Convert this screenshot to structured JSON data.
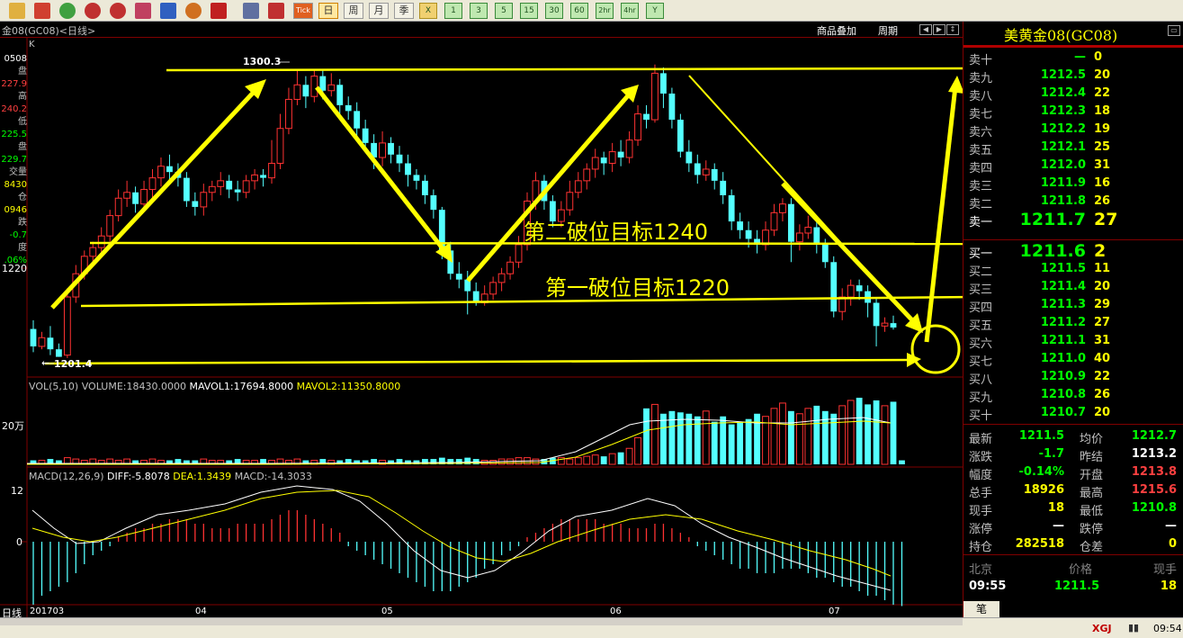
{
  "toolbar": {
    "buttons": [
      "daily",
      "weekly",
      "monthly",
      "quarterly",
      "yearly"
    ],
    "period_labels": [
      "日",
      "周",
      "月",
      "季"
    ],
    "minute_labels": [
      "1",
      "3",
      "5",
      "15",
      "30",
      "60",
      "2hr",
      "4hr",
      "Y"
    ],
    "tick_label": "Tick",
    "close_x": "X"
  },
  "header": {
    "title": "金08(GC08)<日线>",
    "overlay_link": "商品叠加",
    "period_link": "周期",
    "k_label": "K"
  },
  "left_info": [
    {
      "text": "0508",
      "color": "#ffffff"
    },
    {
      "text": "盘",
      "color": "#c0c0c0"
    },
    {
      "text": "227.9",
      "color": "#ff4040"
    },
    {
      "text": "高",
      "color": "#c0c0c0"
    },
    {
      "text": "240.2",
      "color": "#ff4040"
    },
    {
      "text": "低",
      "color": "#c0c0c0"
    },
    {
      "text": "225.5",
      "color": "#00ff00"
    },
    {
      "text": "盘",
      "color": "#c0c0c0"
    },
    {
      "text": "229.7",
      "color": "#00ff00"
    },
    {
      "text": "交量",
      "color": "#c0c0c0"
    },
    {
      "text": "8430",
      "color": "#ffff00"
    },
    {
      "text": "仓",
      "color": "#c0c0c0"
    },
    {
      "text": "0946",
      "color": "#ffff00"
    },
    {
      "text": "跌",
      "color": "#c0c0c0"
    },
    {
      "text": "-0.7",
      "color": "#00ff00"
    },
    {
      "text": "度",
      "color": "#c0c0c0"
    },
    {
      "text": ".06%",
      "color": "#00ff00"
    }
  ],
  "price_axis": {
    "label_1220": "1220"
  },
  "annotations": {
    "high_label": "1300.3",
    "low_label": "1201.4",
    "target2": "第二破位目标1240",
    "target1": "第一破位目标1220"
  },
  "volume_legend": {
    "prefix": "VOL(5,10)",
    "volume": "VOLUME:18430.0000",
    "mavol1": "MAVOL1:17694.8000",
    "mavol2": "MAVOL2:11350.8000",
    "axis_label": "20万"
  },
  "macd_legend": {
    "prefix": "MACD(12,26,9)",
    "diff": "DIFF:-5.8078",
    "dea": "DEA:1.3439",
    "macd": "MACD:-14.3033",
    "axis_top": "12",
    "axis_zero": "0"
  },
  "x_axis": {
    "period_label": "日线",
    "ticks": [
      "201703",
      "04",
      "05",
      "06",
      "07"
    ]
  },
  "colors": {
    "up": "#ff3232",
    "down": "#54ffff",
    "annotation": "#ffff00",
    "grid": "#800000"
  },
  "right_panel": {
    "title": "美黄金08(GC08)",
    "sell_rows": [
      {
        "label": "卖十",
        "price": "—",
        "qty": "0"
      },
      {
        "label": "卖九",
        "price": "1212.5",
        "qty": "20"
      },
      {
        "label": "卖八",
        "price": "1212.4",
        "qty": "22"
      },
      {
        "label": "卖七",
        "price": "1212.3",
        "qty": "18"
      },
      {
        "label": "卖六",
        "price": "1212.2",
        "qty": "19"
      },
      {
        "label": "卖五",
        "price": "1212.1",
        "qty": "25"
      },
      {
        "label": "卖四",
        "price": "1212.0",
        "qty": "31"
      },
      {
        "label": "卖三",
        "price": "1211.9",
        "qty": "16"
      },
      {
        "label": "卖二",
        "price": "1211.8",
        "qty": "26"
      },
      {
        "label": "卖一",
        "price": "1211.7",
        "qty": "27"
      }
    ],
    "buy_rows": [
      {
        "label": "买一",
        "price": "1211.6",
        "qty": "2"
      },
      {
        "label": "买二",
        "price": "1211.5",
        "qty": "11"
      },
      {
        "label": "买三",
        "price": "1211.4",
        "qty": "20"
      },
      {
        "label": "买四",
        "price": "1211.3",
        "qty": "29"
      },
      {
        "label": "买五",
        "price": "1211.2",
        "qty": "27"
      },
      {
        "label": "买六",
        "price": "1211.1",
        "qty": "31"
      },
      {
        "label": "买七",
        "price": "1211.0",
        "qty": "40"
      },
      {
        "label": "买八",
        "price": "1210.9",
        "qty": "22"
      },
      {
        "label": "买九",
        "price": "1210.8",
        "qty": "26"
      },
      {
        "label": "买十",
        "price": "1210.7",
        "qty": "20"
      }
    ],
    "stats": [
      {
        "l1": "最新",
        "v1": "1211.5",
        "c1": "#00ff00",
        "l2": "均价",
        "v2": "1212.7",
        "c2": "#00ff00"
      },
      {
        "l1": "涨跌",
        "v1": "-1.7",
        "c1": "#00ff00",
        "l2": "昨结",
        "v2": "1213.2",
        "c2": "#ffffff"
      },
      {
        "l1": "幅度",
        "v1": "-0.14%",
        "c1": "#00ff00",
        "l2": "开盘",
        "v2": "1213.8",
        "c2": "#ff4040"
      },
      {
        "l1": "总手",
        "v1": "18926",
        "c1": "#ffff00",
        "l2": "最高",
        "v2": "1215.6",
        "c2": "#ff4040"
      },
      {
        "l1": "现手",
        "v1": "18",
        "c1": "#ffff00",
        "l2": "最低",
        "v2": "1210.8",
        "c2": "#00ff00"
      },
      {
        "l1": "涨停",
        "v1": "—",
        "c1": "#ffffff",
        "l2": "跌停",
        "v2": "—",
        "c2": "#ffffff"
      },
      {
        "l1": "持仓",
        "v1": "282518",
        "c1": "#ffff00",
        "l2": "仓差",
        "v2": "0",
        "c2": "#ffff00"
      }
    ],
    "tick_header": {
      "place": "北京",
      "price": "价格",
      "qty": "现手"
    },
    "tick_row": {
      "time": "09:55",
      "price": "1211.5",
      "qty": "18"
    },
    "tab": "笔"
  },
  "status": {
    "brand": "XGJ",
    "time": "09:54"
  },
  "chart_data": {
    "type": "candlestick",
    "price_axis_labels": [
      "1220"
    ],
    "price_range": [
      1196,
      1305
    ],
    "high": 1300.3,
    "low": 1201.4,
    "target_lines": [
      1240,
      1220
    ],
    "candles": [
      {
        "o": 1211,
        "c": 1205,
        "h": 1214,
        "l": 1203
      },
      {
        "o": 1205,
        "c": 1208,
        "h": 1210,
        "l": 1204
      },
      {
        "o": 1208,
        "c": 1204,
        "h": 1212,
        "l": 1202
      },
      {
        "o": 1204,
        "c": 1201.4,
        "h": 1206,
        "l": 1201.4
      },
      {
        "o": 1202,
        "c": 1222,
        "h": 1225,
        "l": 1201
      },
      {
        "o": 1222,
        "c": 1230,
        "h": 1233,
        "l": 1220
      },
      {
        "o": 1230,
        "c": 1236,
        "h": 1238,
        "l": 1228
      },
      {
        "o": 1236,
        "c": 1239,
        "h": 1241,
        "l": 1233
      },
      {
        "o": 1239,
        "c": 1243,
        "h": 1246,
        "l": 1237
      },
      {
        "o": 1243,
        "c": 1250,
        "h": 1252,
        "l": 1241
      },
      {
        "o": 1250,
        "c": 1256,
        "h": 1259,
        "l": 1248
      },
      {
        "o": 1256,
        "c": 1258,
        "h": 1262,
        "l": 1253
      },
      {
        "o": 1258,
        "c": 1254,
        "h": 1260,
        "l": 1251
      },
      {
        "o": 1254,
        "c": 1259,
        "h": 1262,
        "l": 1252
      },
      {
        "o": 1259,
        "c": 1263,
        "h": 1266,
        "l": 1256
      },
      {
        "o": 1263,
        "c": 1267,
        "h": 1270,
        "l": 1260
      },
      {
        "o": 1267,
        "c": 1265,
        "h": 1271,
        "l": 1262
      },
      {
        "o": 1265,
        "c": 1263,
        "h": 1268,
        "l": 1260
      },
      {
        "o": 1263,
        "c": 1255,
        "h": 1265,
        "l": 1253
      },
      {
        "o": 1255,
        "c": 1253,
        "h": 1258,
        "l": 1250
      },
      {
        "o": 1253,
        "c": 1258,
        "h": 1261,
        "l": 1250
      },
      {
        "o": 1258,
        "c": 1260,
        "h": 1262,
        "l": 1255
      },
      {
        "o": 1260,
        "c": 1262,
        "h": 1265,
        "l": 1257
      },
      {
        "o": 1262,
        "c": 1259,
        "h": 1264,
        "l": 1256
      },
      {
        "o": 1259,
        "c": 1258,
        "h": 1262,
        "l": 1255
      },
      {
        "o": 1258,
        "c": 1262,
        "h": 1264,
        "l": 1256
      },
      {
        "o": 1262,
        "c": 1264,
        "h": 1266,
        "l": 1259
      },
      {
        "o": 1264,
        "c": 1263,
        "h": 1266,
        "l": 1260
      },
      {
        "o": 1263,
        "c": 1268,
        "h": 1276,
        "l": 1261
      },
      {
        "o": 1268,
        "c": 1280,
        "h": 1285,
        "l": 1266
      },
      {
        "o": 1280,
        "c": 1290,
        "h": 1294,
        "l": 1278
      },
      {
        "o": 1290,
        "c": 1295,
        "h": 1300.3,
        "l": 1288
      },
      {
        "o": 1295,
        "c": 1291,
        "h": 1298,
        "l": 1287
      },
      {
        "o": 1291,
        "c": 1298,
        "h": 1300,
        "l": 1289
      },
      {
        "o": 1298,
        "c": 1293,
        "h": 1300,
        "l": 1290
      },
      {
        "o": 1293,
        "c": 1295,
        "h": 1299,
        "l": 1291
      },
      {
        "o": 1295,
        "c": 1288,
        "h": 1297,
        "l": 1285
      },
      {
        "o": 1288,
        "c": 1286,
        "h": 1291,
        "l": 1283
      },
      {
        "o": 1286,
        "c": 1280,
        "h": 1289,
        "l": 1277
      },
      {
        "o": 1280,
        "c": 1275,
        "h": 1283,
        "l": 1272
      },
      {
        "o": 1275,
        "c": 1270,
        "h": 1278,
        "l": 1266
      },
      {
        "o": 1270,
        "c": 1275,
        "h": 1279,
        "l": 1267
      },
      {
        "o": 1275,
        "c": 1271,
        "h": 1277,
        "l": 1268
      },
      {
        "o": 1271,
        "c": 1268,
        "h": 1274,
        "l": 1265
      },
      {
        "o": 1268,
        "c": 1264,
        "h": 1271,
        "l": 1260
      },
      {
        "o": 1264,
        "c": 1262,
        "h": 1266,
        "l": 1259
      },
      {
        "o": 1262,
        "c": 1257,
        "h": 1264,
        "l": 1254
      },
      {
        "o": 1257,
        "c": 1252,
        "h": 1259,
        "l": 1249
      },
      {
        "o": 1252,
        "c": 1238,
        "h": 1253,
        "l": 1235
      },
      {
        "o": 1238,
        "c": 1230,
        "h": 1241,
        "l": 1228
      },
      {
        "o": 1230,
        "c": 1228,
        "h": 1234,
        "l": 1225
      },
      {
        "o": 1228,
        "c": 1224,
        "h": 1231,
        "l": 1216
      },
      {
        "o": 1224,
        "c": 1220,
        "h": 1227,
        "l": 1219
      },
      {
        "o": 1220,
        "c": 1223,
        "h": 1226,
        "l": 1219
      },
      {
        "o": 1223,
        "c": 1227,
        "h": 1229,
        "l": 1221
      },
      {
        "o": 1227,
        "c": 1230,
        "h": 1232,
        "l": 1224
      },
      {
        "o": 1230,
        "c": 1234,
        "h": 1236,
        "l": 1228
      },
      {
        "o": 1234,
        "c": 1240,
        "h": 1243,
        "l": 1232
      },
      {
        "o": 1240,
        "c": 1255,
        "h": 1258,
        "l": 1238
      },
      {
        "o": 1255,
        "c": 1262,
        "h": 1265,
        "l": 1252
      },
      {
        "o": 1262,
        "c": 1255,
        "h": 1264,
        "l": 1252
      },
      {
        "o": 1255,
        "c": 1248,
        "h": 1257,
        "l": 1246
      },
      {
        "o": 1248,
        "c": 1252,
        "h": 1255,
        "l": 1246
      },
      {
        "o": 1252,
        "c": 1258,
        "h": 1262,
        "l": 1250
      },
      {
        "o": 1258,
        "c": 1262,
        "h": 1265,
        "l": 1256
      },
      {
        "o": 1262,
        "c": 1266,
        "h": 1268,
        "l": 1259
      },
      {
        "o": 1266,
        "c": 1270,
        "h": 1273,
        "l": 1263
      },
      {
        "o": 1270,
        "c": 1268,
        "h": 1272,
        "l": 1264
      },
      {
        "o": 1268,
        "c": 1272,
        "h": 1275,
        "l": 1265
      },
      {
        "o": 1272,
        "c": 1270,
        "h": 1276,
        "l": 1267
      },
      {
        "o": 1270,
        "c": 1276,
        "h": 1279,
        "l": 1268
      },
      {
        "o": 1276,
        "c": 1285,
        "h": 1288,
        "l": 1274
      },
      {
        "o": 1285,
        "c": 1283,
        "h": 1288,
        "l": 1280
      },
      {
        "o": 1283,
        "c": 1299,
        "h": 1302,
        "l": 1282
      },
      {
        "o": 1299,
        "c": 1292,
        "h": 1301,
        "l": 1287
      },
      {
        "o": 1292,
        "c": 1283,
        "h": 1294,
        "l": 1280
      },
      {
        "o": 1283,
        "c": 1272,
        "h": 1285,
        "l": 1270
      },
      {
        "o": 1272,
        "c": 1268,
        "h": 1276,
        "l": 1265
      },
      {
        "o": 1268,
        "c": 1264,
        "h": 1271,
        "l": 1261
      },
      {
        "o": 1264,
        "c": 1266,
        "h": 1269,
        "l": 1262
      },
      {
        "o": 1266,
        "c": 1262,
        "h": 1268,
        "l": 1259
      },
      {
        "o": 1262,
        "c": 1257,
        "h": 1265,
        "l": 1254
      },
      {
        "o": 1257,
        "c": 1248,
        "h": 1259,
        "l": 1245
      },
      {
        "o": 1248,
        "c": 1245,
        "h": 1251,
        "l": 1242
      },
      {
        "o": 1245,
        "c": 1242,
        "h": 1248,
        "l": 1239
      },
      {
        "o": 1242,
        "c": 1240,
        "h": 1245,
        "l": 1237
      },
      {
        "o": 1240,
        "c": 1245,
        "h": 1248,
        "l": 1238
      },
      {
        "o": 1245,
        "c": 1251,
        "h": 1254,
        "l": 1243
      },
      {
        "o": 1251,
        "c": 1254,
        "h": 1256,
        "l": 1248
      },
      {
        "o": 1254,
        "c": 1241,
        "h": 1256,
        "l": 1234
      },
      {
        "o": 1241,
        "c": 1244,
        "h": 1247,
        "l": 1238
      },
      {
        "o": 1244,
        "c": 1246,
        "h": 1250,
        "l": 1242
      },
      {
        "o": 1246,
        "c": 1240,
        "h": 1248,
        "l": 1237
      },
      {
        "o": 1240,
        "c": 1234,
        "h": 1242,
        "l": 1232
      },
      {
        "o": 1234,
        "c": 1217,
        "h": 1236,
        "l": 1215
      },
      {
        "o": 1217,
        "c": 1222,
        "h": 1225,
        "l": 1214
      },
      {
        "o": 1222,
        "c": 1226,
        "h": 1228,
        "l": 1219
      },
      {
        "o": 1226,
        "c": 1224,
        "h": 1228,
        "l": 1221
      },
      {
        "o": 1224,
        "c": 1220,
        "h": 1226,
        "l": 1215
      },
      {
        "o": 1220,
        "c": 1212,
        "h": 1222,
        "l": 1205
      },
      {
        "o": 1212,
        "c": 1213,
        "h": 1215,
        "l": 1210
      },
      {
        "o": 1213,
        "c": 1211.5,
        "h": 1215.6,
        "l": 1210.8
      }
    ],
    "volume": [
      3,
      3,
      4,
      3,
      5,
      4,
      3,
      4,
      3,
      4,
      3,
      4,
      3,
      3,
      4,
      3,
      3,
      4,
      3,
      3,
      4,
      3,
      3,
      3,
      4,
      3,
      3,
      4,
      3,
      4,
      3,
      4,
      3,
      3,
      4,
      3,
      3,
      4,
      3,
      3,
      4,
      3,
      3,
      4,
      3,
      3,
      4,
      4,
      5,
      4,
      4,
      5,
      4,
      3,
      3,
      4,
      4,
      5,
      5,
      4,
      4,
      5,
      5,
      4,
      5,
      6,
      7,
      6,
      8,
      9,
      12,
      20,
      42,
      45,
      38,
      40,
      39,
      38,
      36,
      40,
      32,
      36,
      30,
      32,
      34,
      38,
      36,
      42,
      46,
      40,
      38,
      42,
      44,
      40,
      38,
      44,
      48,
      50,
      45,
      48,
      44,
      47,
      3
    ],
    "macd_hist": [
      -14,
      -12,
      -11,
      -10,
      -9,
      -7,
      -5,
      -3,
      -2,
      -1,
      1,
      2,
      3,
      3,
      4,
      4,
      5,
      5,
      5,
      4,
      4,
      3,
      3,
      3,
      4,
      4,
      4,
      4,
      5,
      6,
      7,
      7,
      6,
      5,
      4,
      3,
      2,
      -1,
      -2,
      -3,
      -4,
      -5,
      -6,
      -7,
      -8,
      -9,
      -10,
      -11,
      -11,
      -11,
      -10,
      -9,
      -8,
      -6,
      -5,
      -3,
      -2,
      -1,
      1,
      2,
      3,
      4,
      5,
      5,
      5,
      5,
      5,
      4,
      4,
      4,
      3,
      3,
      3,
      4,
      4,
      3,
      2,
      1,
      -1,
      -2,
      -3,
      -4,
      -5,
      -6,
      -6,
      -7,
      -7,
      -7,
      -6,
      -6,
      -6,
      -7,
      -8,
      -8,
      -9,
      -10,
      -10,
      -11,
      -12,
      -12,
      -13,
      -14,
      -14.3
    ]
  }
}
